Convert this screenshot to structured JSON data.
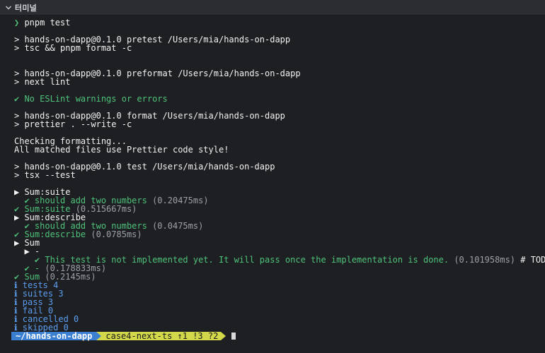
{
  "panel": {
    "title": "터미널"
  },
  "prompt_symbol": "❯",
  "lines": [
    {
      "text": " pnpm test",
      "cls": "white",
      "prefix": "❯",
      "prefix_cls": "g"
    },
    {
      "text": "",
      "cls": ""
    },
    {
      "text": "> hands-on-dapp@0.1.0 pretest /Users/mia/hands-on-dapp",
      "cls": "white"
    },
    {
      "text": "> tsc && pnpm format -c",
      "cls": "white"
    },
    {
      "text": "",
      "cls": ""
    },
    {
      "text": "",
      "cls": ""
    },
    {
      "text": "> hands-on-dapp@0.1.0 preformat /Users/mia/hands-on-dapp",
      "cls": "white"
    },
    {
      "text": "> next lint",
      "cls": "white"
    },
    {
      "text": "",
      "cls": ""
    },
    {
      "text": "✔ No ESLint warnings or errors",
      "cls": "g"
    },
    {
      "text": "",
      "cls": ""
    },
    {
      "text": "> hands-on-dapp@0.1.0 format /Users/mia/hands-on-dapp",
      "cls": "white"
    },
    {
      "text": "> prettier . --write -c",
      "cls": "white"
    },
    {
      "text": "",
      "cls": ""
    },
    {
      "text": "Checking formatting...",
      "cls": "white"
    },
    {
      "text": "All matched files use Prettier code style!",
      "cls": "white"
    },
    {
      "text": "",
      "cls": ""
    },
    {
      "text": "> hands-on-dapp@0.1.0 test /Users/mia/hands-on-dapp",
      "cls": "white"
    },
    {
      "text": "> tsx --test",
      "cls": "white"
    },
    {
      "text": "",
      "cls": ""
    },
    {
      "text": "▶ Sum:suite",
      "cls": "white"
    },
    {
      "text": "  ✔ should add two numbers",
      "cls": "g",
      "suffix": " (0.20475ms)",
      "suffix_cls": "gray"
    },
    {
      "text": "✔ Sum:suite",
      "cls": "g",
      "suffix": " (0.515667ms)",
      "suffix_cls": "gray"
    },
    {
      "text": "▶ Sum:describe",
      "cls": "white"
    },
    {
      "text": "  ✔ should add two numbers",
      "cls": "g",
      "suffix": " (0.0475ms)",
      "suffix_cls": "gray"
    },
    {
      "text": "✔ Sum:describe",
      "cls": "g",
      "suffix": " (0.0785ms)",
      "suffix_cls": "gray"
    },
    {
      "text": "▶ Sum",
      "cls": "white"
    },
    {
      "text": "  ▶ -",
      "cls": "white"
    },
    {
      "text": "    ✔ This test is not implemented yet. It will pass once the implementation is done.",
      "cls": "g",
      "suffix": " (0.101958ms)",
      "suffix_cls": "gray",
      "tail": " # TODO",
      "tail_cls": "white"
    },
    {
      "text": "  ✔ -",
      "cls": "g",
      "suffix": " (0.178833ms)",
      "suffix_cls": "gray"
    },
    {
      "text": "✔ Sum",
      "cls": "g",
      "suffix": " (0.2145ms)",
      "suffix_cls": "gray"
    },
    {
      "text": "ℹ tests 4",
      "cls": "info"
    },
    {
      "text": "ℹ suites 3",
      "cls": "info"
    },
    {
      "text": "ℹ pass 3",
      "cls": "info"
    },
    {
      "text": "ℹ fail 0",
      "cls": "info"
    },
    {
      "text": "ℹ cancelled 0",
      "cls": "info"
    },
    {
      "text": "ℹ skipped 0",
      "cls": "info"
    }
  ],
  "prompt_bar": {
    "path": "~/hands-on-dapp",
    "git": "case4-next-ts ↑1 !3 ?2"
  },
  "colors": {
    "background": "#1e1f22",
    "success": "#4ec27b",
    "info": "#5b9ef0",
    "path_segment": "#3a7fd0",
    "git_segment": "#d2d84a"
  }
}
